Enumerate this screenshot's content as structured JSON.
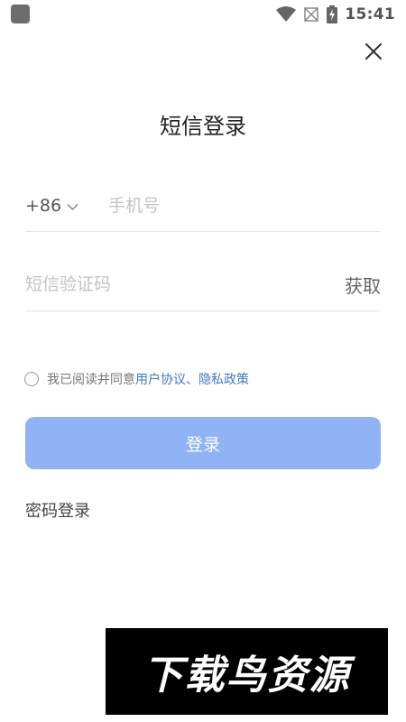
{
  "status_bar": {
    "time": "15:41",
    "icons": [
      "app-icon",
      "wifi-icon",
      "no-signal-icon",
      "battery-charging-icon"
    ]
  },
  "header": {
    "close_icon": "close-icon",
    "title": "短信登录"
  },
  "phone_field": {
    "country_code": "+86",
    "dropdown_icon": "chevron-down-icon",
    "value": "",
    "placeholder": "手机号"
  },
  "code_field": {
    "value": "",
    "placeholder": "短信验证码",
    "get_code_label": "获取"
  },
  "agreement": {
    "checked": false,
    "prefix": "我已阅读并同意",
    "user_agreement": "用户协议",
    "separator": "、",
    "privacy_policy": "隐私政策"
  },
  "login_button": {
    "label": "登录",
    "color": "#8fb3f5"
  },
  "alt_login": {
    "password_login_label": "密码登录"
  },
  "watermark": {
    "text": "下载鸟资源"
  },
  "colors": {
    "link": "#3f79c8",
    "primary_button": "#8fb3f5",
    "divider": "#e6e6e6"
  }
}
